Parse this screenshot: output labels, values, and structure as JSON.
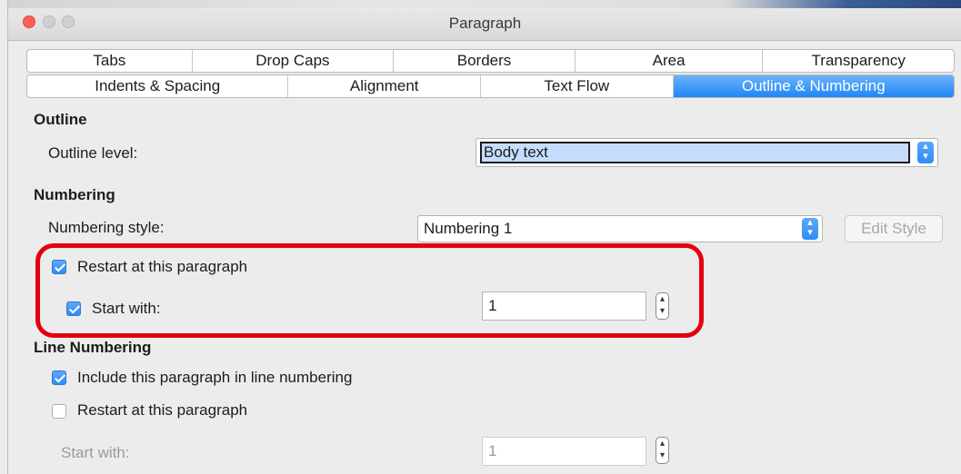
{
  "window": {
    "title": "Paragraph"
  },
  "tabs_row1": [
    "Tabs",
    "Drop Caps",
    "Borders",
    "Area",
    "Transparency"
  ],
  "tabs_row2": [
    "Indents & Spacing",
    "Alignment",
    "Text Flow",
    "Outline & Numbering"
  ],
  "outline": {
    "section_title": "Outline",
    "level_label": "Outline level:",
    "level_value": "Body text"
  },
  "numbering": {
    "section_title": "Numbering",
    "style_label": "Numbering style:",
    "style_value": "Numbering 1",
    "edit_style_button": "Edit Style",
    "restart_label": "Restart at this paragraph",
    "restart_checked": true,
    "start_with_label": "Start with:",
    "start_with_checked": true,
    "start_with_value": "1"
  },
  "line_numbering": {
    "section_title": "Line Numbering",
    "include_label": "Include this paragraph in line numbering",
    "include_checked": true,
    "restart_label": "Restart at this paragraph",
    "restart_checked": false,
    "start_with_label": "Start with:",
    "start_with_value": "1"
  },
  "colors": {
    "accent": "#2e8cf6",
    "highlight": "#e3000f"
  }
}
